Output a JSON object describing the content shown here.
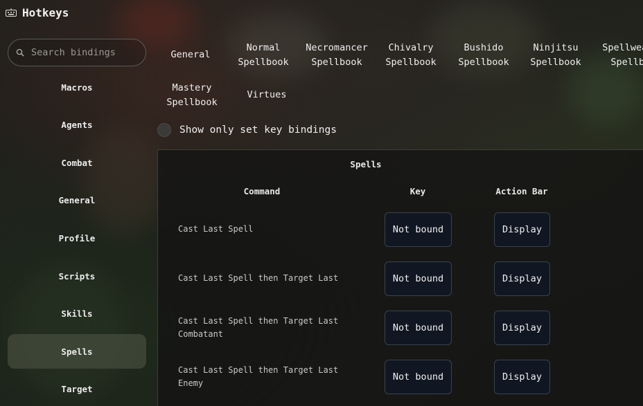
{
  "window": {
    "title": "Hotkeys",
    "icon": "keyboard-icon"
  },
  "search": {
    "placeholder": "Search bindings",
    "value": ""
  },
  "sidebar": {
    "items": [
      {
        "label": "Macros"
      },
      {
        "label": "Agents"
      },
      {
        "label": "Combat"
      },
      {
        "label": "General"
      },
      {
        "label": "Profile"
      },
      {
        "label": "Scripts"
      },
      {
        "label": "Skills"
      },
      {
        "label": "Spells",
        "active": true
      },
      {
        "label": "Target"
      }
    ]
  },
  "tabs": [
    {
      "label": "General"
    },
    {
      "label": "Normal\nSpellbook"
    },
    {
      "label": "Necromancer\nSpellbook"
    },
    {
      "label": "Chivalry\nSpellbook"
    },
    {
      "label": "Bushido\nSpellbook"
    },
    {
      "label": "Ninjitsu\nSpellbook"
    },
    {
      "label": "Spellweaving\nSpellbook"
    },
    {
      "label": "Mastery\nSpellbook"
    },
    {
      "label": "Virtues"
    }
  ],
  "filter": {
    "label": "Show only set key bindings",
    "checked": false
  },
  "panel": {
    "title": "Spells",
    "columns": {
      "command": "Command",
      "key": "Key",
      "action_bar": "Action Bar"
    },
    "rows": [
      {
        "command": "Cast Last Spell",
        "key": "Not bound",
        "action": "Display"
      },
      {
        "command": "Cast Last Spell then Target Last",
        "key": "Not bound",
        "action": "Display"
      },
      {
        "command": "Cast Last Spell then Target Last Combatant",
        "key": "Not bound",
        "action": "Display"
      },
      {
        "command": "Cast Last Spell then Target Last Enemy",
        "key": "Not bound",
        "action": "Display"
      }
    ]
  }
}
